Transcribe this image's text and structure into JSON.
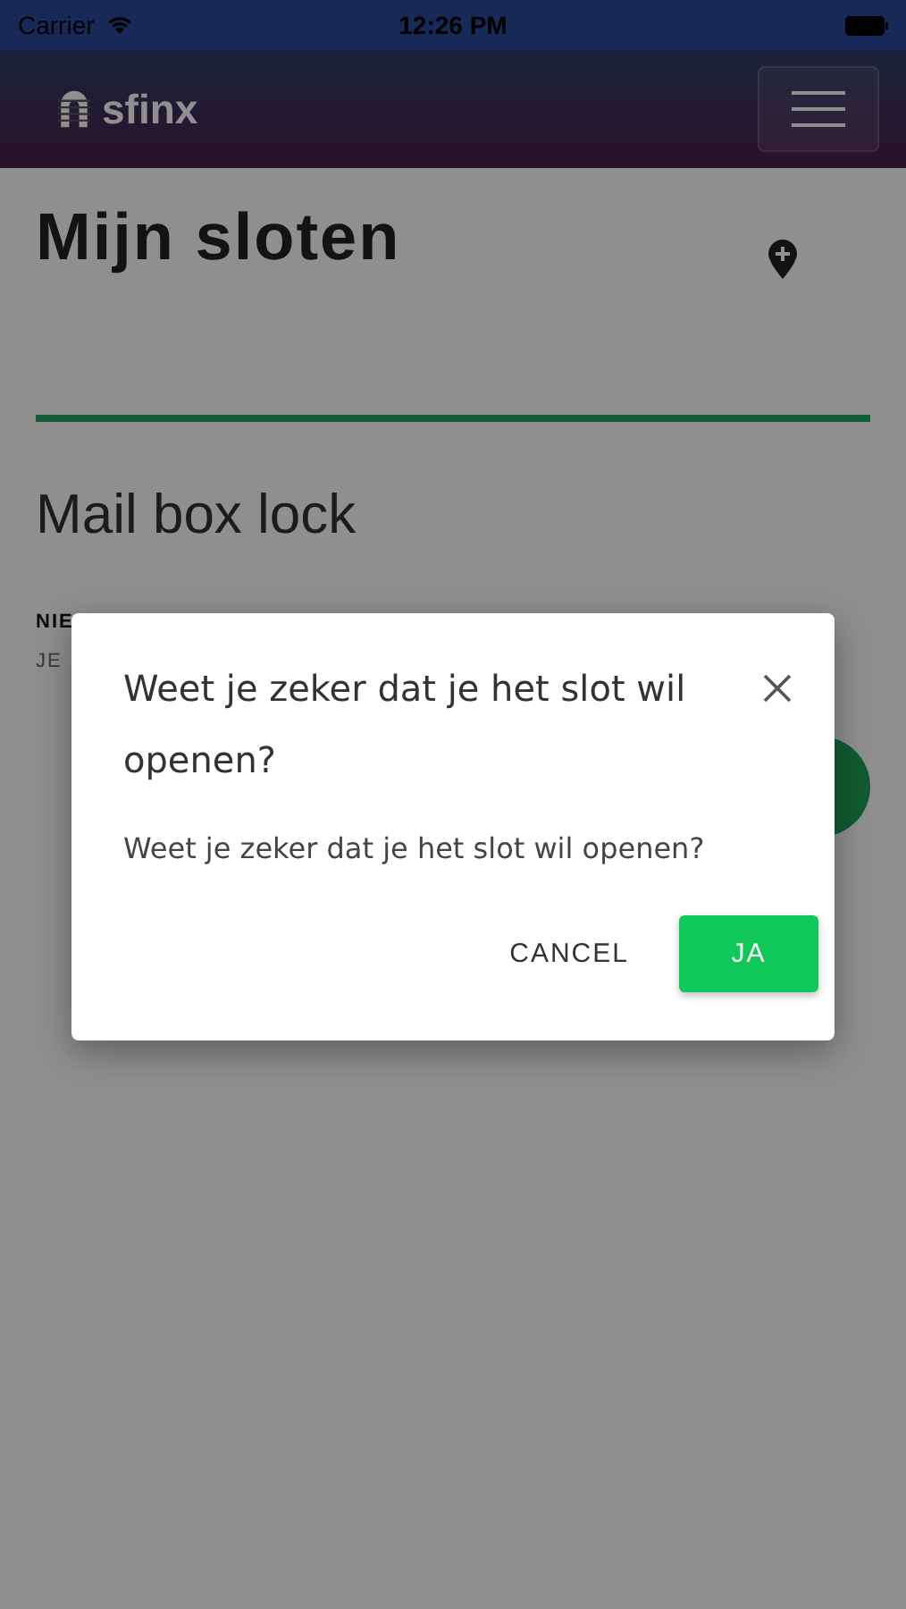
{
  "status_bar": {
    "carrier": "Carrier",
    "time": "12:26 PM"
  },
  "navbar": {
    "brand": "sfinx"
  },
  "page": {
    "title": "Mijn sloten",
    "lock": {
      "name": "Mail box lock",
      "status": "NIE",
      "hint": "JE"
    }
  },
  "dialog": {
    "title": "Weet je zeker dat je het slot wil openen?",
    "message": "Weet je zeker dat je het slot wil openen?",
    "buttons": [
      {
        "label": "CANCEL",
        "kind": "text"
      },
      {
        "label": "JA",
        "kind": "primary"
      }
    ]
  }
}
